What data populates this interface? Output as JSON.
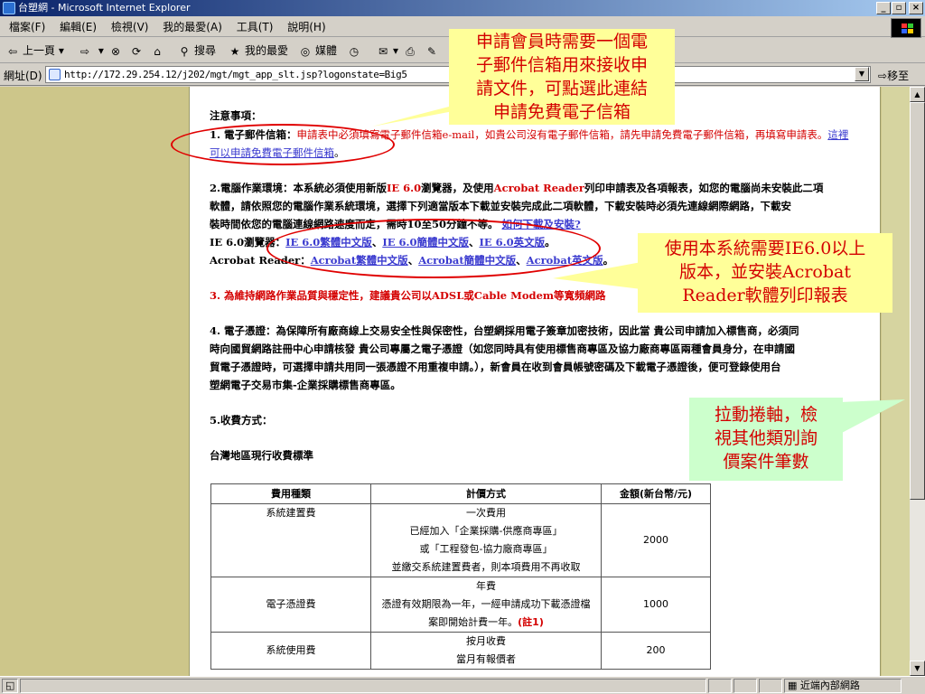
{
  "window": {
    "title": "台塑網 - Microsoft Internet Explorer",
    "minimize": "_",
    "maximize": "▫",
    "close": "×"
  },
  "menu": [
    "檔案(F)",
    "編輯(E)",
    "檢視(V)",
    "我的最愛(A)",
    "工具(T)",
    "說明(H)"
  ],
  "toolbar": {
    "back": "上一頁",
    "search": "搜尋",
    "favorites": "我的最愛",
    "media": "媒體"
  },
  "address": {
    "label": "網址(D)",
    "url": "http://172.29.254.12/j202/mgt/mgt_app_slt.jsp?logonstate=Big5",
    "go": "移至"
  },
  "status": {
    "zone": "近端內部網路"
  },
  "notes": {
    "heading": "注意事項：",
    "n1_label": "1. 電子郵件信箱：",
    "n1_text": "申請表中必須填寫電子郵件信箱e-mail，如貴公司沒有電子郵件信箱，請先申請免費電子郵件信箱，再填寫申請表。",
    "n1_link_a": "這裡",
    "n1_link_b": "可以申請免費電子郵件信箱",
    "n1_end": "。",
    "n2_label": "2.電腦作業環境：本系統必須使用新版",
    "n2_ie": "IE 6.0",
    "n2_mid": "瀏覽器，及使用",
    "n2_acro": "Acrobat Reader",
    "n2_rest": "列印申請表及各項報表，如您的電腦尚未安裝此二項",
    "n2_line2": "軟體，請依照您的電腦作業系統環境，選擇下列適當版本下載並安裝完成此二項軟體，下載安裝時必須先連線網際網路，下載安",
    "n2_line3": "裝時間依您的電腦連線網路速度而定，需時10至50分鐘不等。",
    "n2_howto": "如何下載及安裝?",
    "ie_label": "IE 6.0瀏覽器：",
    "ie_links": [
      "IE 6.0繁體中文版",
      "IE 6.0簡體中文版",
      "IE 6.0英文版"
    ],
    "acro_label": "Acrobat Reader：",
    "acro_links": [
      "Acrobat繁體中文版",
      "Acrobat簡體中文版",
      "Acrobat英文版"
    ],
    "sep": "、",
    "end": "。",
    "n3": "3. 為維持網路作業品質與穩定性，建議貴公司以ADSL或Cable Modem等寬頻網路",
    "n4_line1": "4. 電子憑證：為保障所有廠商線上交易安全性與保密性，台塑網採用電子簽章加密技術，因此當 貴公司申請加入標售商，必須同",
    "n4_line2": "時向國貿網路註冊中心申請核發 貴公司專屬之電子憑證（如您同時具有使用標售商專區及協力廠商專區兩種會員身分，在申請國",
    "n4_line3": "貿電子憑證時，可選擇申請共用同一張憑證不用重複申請。），新會員在收到會員帳號密碼及下載電子憑證後，便可登錄使用台",
    "n4_line4": "塑網電子交易市集-企業採購標售商專區。",
    "n5": "5.收費方式：",
    "region": "台灣地區現行收費標準"
  },
  "fee_table": {
    "headers": [
      "費用種類",
      "計價方式",
      "金額(新台幣/元)"
    ],
    "rows": [
      {
        "type": "系統建置費",
        "method": [
          "一次費用",
          "已經加入「企業採購-供應商專區」",
          "或「工程發包-協力廠商專區」",
          "並繳交系統建置費者，則本項費用不再收取"
        ],
        "amount": "2000"
      },
      {
        "type": "電子憑證費",
        "method": [
          "年費",
          "憑證有效期限為一年，一經申請成功下載憑證檔",
          "案即開始計費一年。"
        ],
        "note": "(註1)",
        "amount": "1000"
      },
      {
        "type": "系統使用費",
        "method": [
          "按月收費",
          "當月有報價者"
        ],
        "amount": "200"
      }
    ]
  },
  "callouts": {
    "email": [
      "申請會員時需要一個電",
      "子郵件信箱用來接收申",
      "請文件，可點選此連結",
      "申請免費電子信箱"
    ],
    "ie": [
      "使用本系統需要IE6.0以上",
      "版本，並安裝Acrobat",
      "Reader軟體列印報表"
    ],
    "scroll": [
      "拉動捲軸，檢",
      "視其他類別詢",
      "價案件筆數"
    ]
  }
}
